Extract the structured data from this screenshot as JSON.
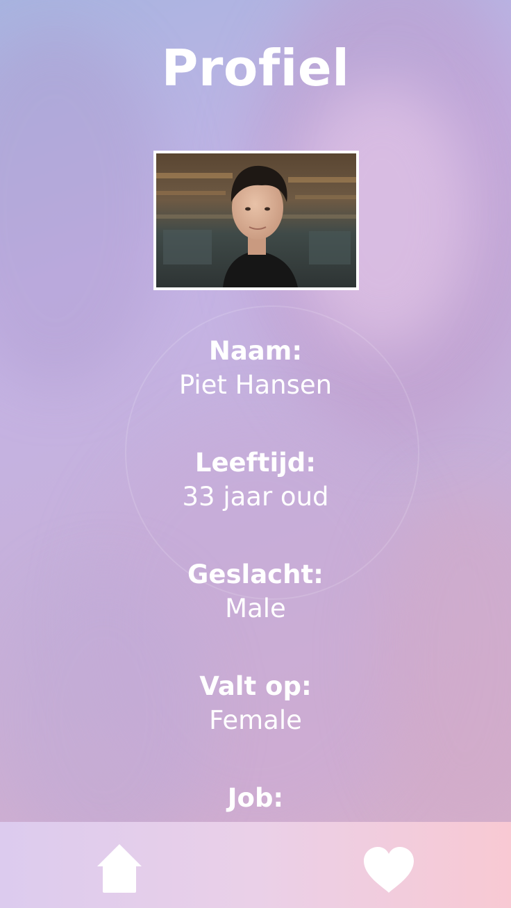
{
  "header": {
    "title": "Profiel"
  },
  "profile": {
    "photo_icon": "profile-photo",
    "fields": [
      {
        "label": "Naam:",
        "value": "Piet Hansen"
      },
      {
        "label": "Leeftijd:",
        "value": "33 jaar oud"
      },
      {
        "label": "Geslacht:",
        "value": "Male"
      },
      {
        "label": "Valt op:",
        "value": "Female"
      },
      {
        "label": "Job:",
        "value": ""
      }
    ]
  },
  "nav": {
    "items": [
      {
        "icon": "home-icon"
      },
      {
        "icon": "heart-icon"
      }
    ]
  },
  "colors": {
    "text": "#ffffff",
    "nav_start": "#dccbee",
    "nav_end": "#f8c9d3"
  }
}
